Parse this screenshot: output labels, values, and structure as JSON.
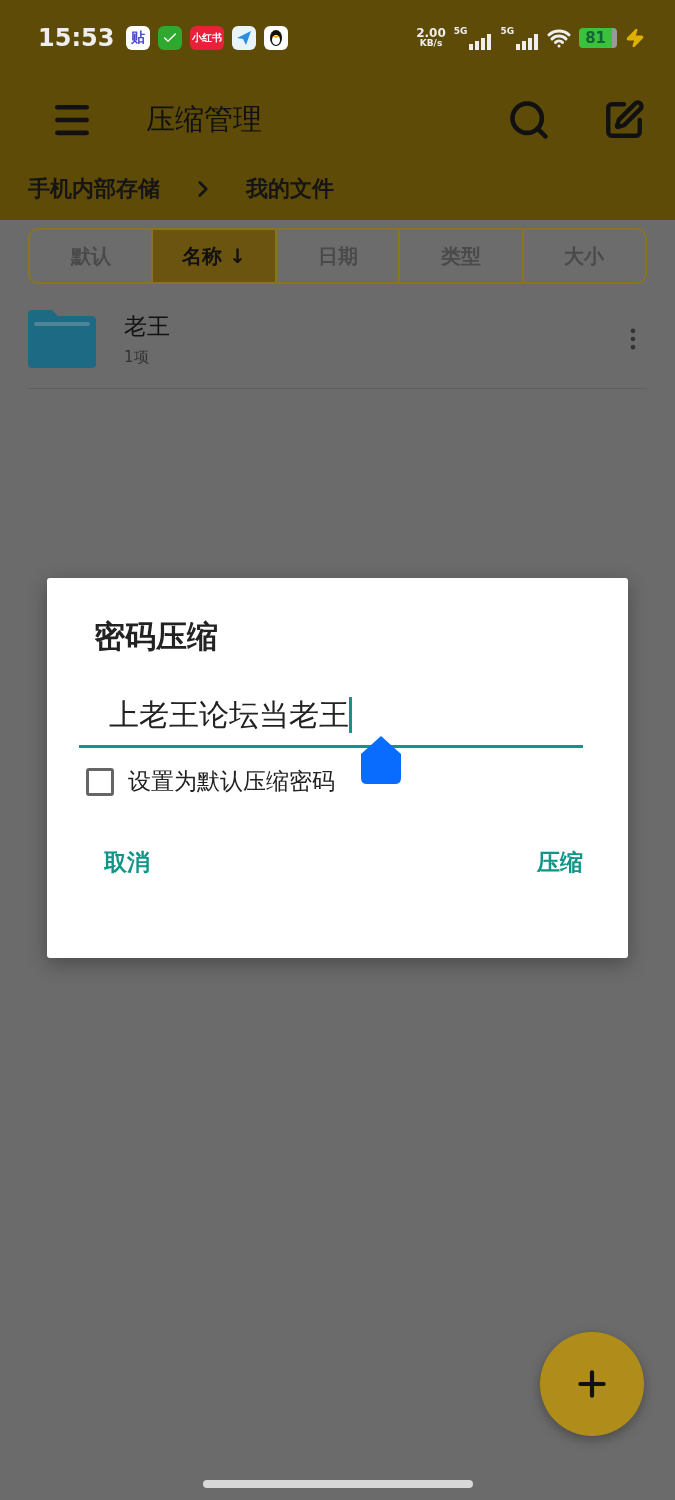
{
  "status_bar": {
    "time": "15:53",
    "app_icons": [
      {
        "kind": "tie",
        "label": "贴"
      },
      {
        "kind": "check"
      },
      {
        "kind": "xhs",
        "label": "小红书"
      },
      {
        "kind": "plane"
      },
      {
        "kind": "penguin"
      }
    ],
    "net_speed": {
      "value": "2.00",
      "unit": "KB/s"
    },
    "signals": [
      {
        "label": "5G"
      },
      {
        "label": "5G"
      }
    ],
    "battery": "81"
  },
  "header": {
    "title": "压缩管理"
  },
  "breadcrumb": [
    "手机内部存储",
    "我的文件"
  ],
  "sort_tabs": [
    {
      "label": "默认",
      "selected": false
    },
    {
      "label": "名称 ↓",
      "selected": true
    },
    {
      "label": "日期",
      "selected": false
    },
    {
      "label": "类型",
      "selected": false
    },
    {
      "label": "大小",
      "selected": false
    }
  ],
  "files": [
    {
      "name": "老王",
      "info": "1项"
    }
  ],
  "dialog": {
    "title": "密码压缩",
    "password": "上老王论坛当老王",
    "checkbox": {
      "label": "设置为默认压缩密码",
      "checked": false
    },
    "buttons": [
      "取消",
      "压缩"
    ]
  }
}
